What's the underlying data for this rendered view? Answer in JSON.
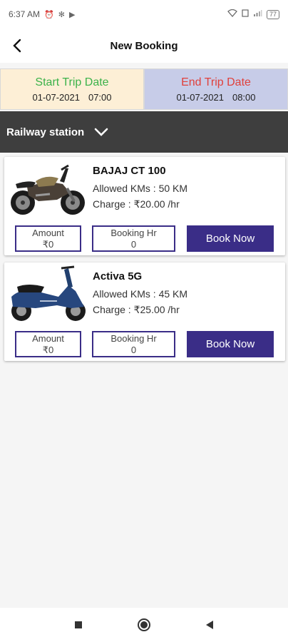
{
  "status_bar": {
    "time": "6:37 AM",
    "battery": "77",
    "icons": [
      "alarm-icon",
      "settings-icon",
      "media-icon",
      "wifi-icon",
      "sim-icon",
      "signal-icon",
      "battery-icon"
    ]
  },
  "app_bar": {
    "title": "New Booking",
    "back_icon": "back-arrow-icon"
  },
  "trip_dates": {
    "start": {
      "label": "Start Trip Date",
      "date": "01-07-2021",
      "time": "07:00",
      "color": "#3bb24a",
      "bg": "#fdefd6"
    },
    "end": {
      "label": "End Trip Date",
      "date": "01-07-2021",
      "time": "08:00",
      "color": "#e0413c",
      "bg": "#c7cce8"
    }
  },
  "location": {
    "label": "Railway station",
    "icon": "chevron-down-icon"
  },
  "vehicles": [
    {
      "name": "BAJAJ CT 100",
      "kms": "Allowed KMs : 50 KM",
      "charge": "Charge : ₹20.00 /hr",
      "amount_label": "Amount",
      "amount_value": "₹0",
      "hours_label": "Booking Hr",
      "hours_value": "0",
      "book_label": "Book Now"
    },
    {
      "name": "Activa 5G",
      "kms": "Allowed KMs : 45 KM",
      "charge": "Charge : ₹25.00 /hr",
      "amount_label": "Amount",
      "amount_value": "₹0",
      "hours_label": "Booking Hr",
      "hours_value": "0",
      "book_label": "Book Now"
    }
  ],
  "theme": {
    "accent": "#3a2d87",
    "location_bg": "#3e3e3e"
  },
  "nav": {
    "icons": [
      "recents-square-icon",
      "home-circle-icon",
      "back-triangle-icon"
    ]
  }
}
